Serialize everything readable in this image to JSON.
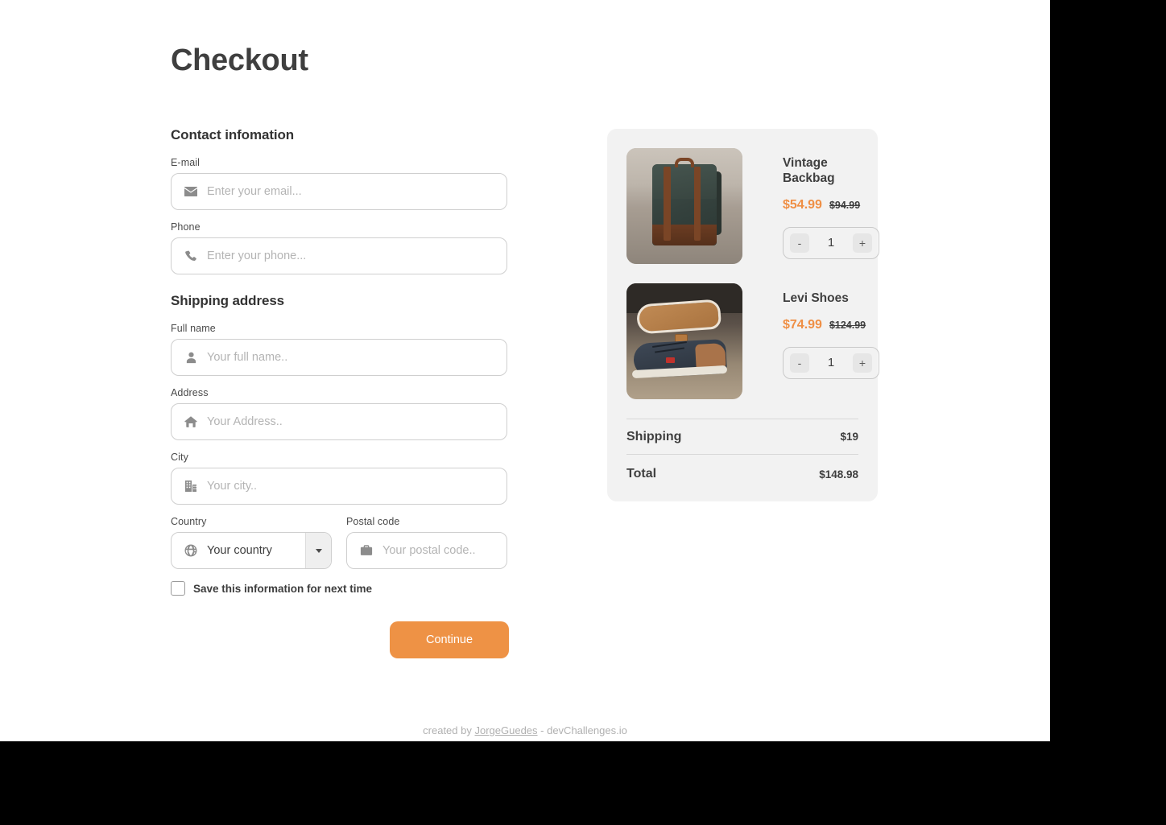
{
  "page": {
    "title": "Checkout"
  },
  "contact": {
    "section_title": "Contact infomation",
    "email": {
      "label": "E-mail",
      "placeholder": "Enter your email...",
      "value": "",
      "icon": "envelope-icon"
    },
    "phone": {
      "label": "Phone",
      "placeholder": "Enter your phone...",
      "value": "",
      "icon": "phone-icon"
    }
  },
  "shipping": {
    "section_title": "Shipping address",
    "full_name": {
      "label": "Full name",
      "placeholder": "Your full name..",
      "value": "",
      "icon": "person-icon"
    },
    "address": {
      "label": "Address",
      "placeholder": "Your Address..",
      "value": "",
      "icon": "home-icon"
    },
    "city": {
      "label": "City",
      "placeholder": "Your city..",
      "value": "",
      "icon": "building-icon"
    },
    "country": {
      "label": "Country",
      "selected": "Your country",
      "icon": "globe-icon",
      "arrow_icon": "caret-down-icon"
    },
    "postal_code": {
      "label": "Postal code",
      "placeholder": "Your postal code..",
      "value": "",
      "icon": "briefcase-icon"
    }
  },
  "save_info": {
    "label": "Save this information for next time",
    "checked": false
  },
  "submit": {
    "label": "Continue"
  },
  "summary": {
    "products": [
      {
        "name": "Vintage Backbag",
        "sale_price": "$54.99",
        "original_price": "$94.99",
        "quantity": "1",
        "decrement_label": "-",
        "increment_label": "+",
        "image": "vintage-backpack-photo"
      },
      {
        "name": "Levi Shoes",
        "sale_price": "$74.99",
        "original_price": "$124.99",
        "quantity": "1",
        "decrement_label": "-",
        "increment_label": "+",
        "image": "levi-shoes-photo"
      }
    ],
    "shipping": {
      "label": "Shipping",
      "value": "$19"
    },
    "total": {
      "label": "Total",
      "value": "$148.98"
    }
  },
  "footer": {
    "prefix": "created by ",
    "author": "JorgeGuedes",
    "suffix": " - devChallenges.io"
  },
  "colors": {
    "accent": "#ee9245",
    "sale_price": "#ef8f45",
    "panel_bg": "#f2f2f2",
    "text": "#3f3f3f",
    "border": "#cfcfcf",
    "placeholder": "#b4b4b4"
  }
}
